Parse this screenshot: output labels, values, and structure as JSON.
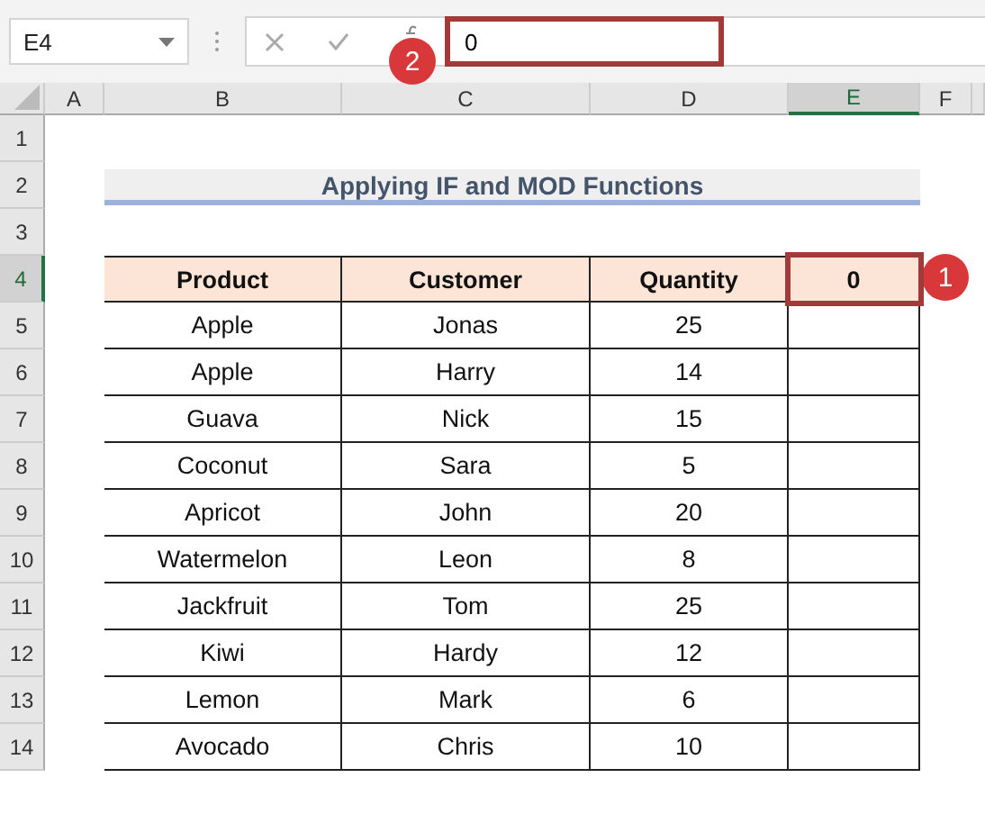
{
  "name_box": "E4",
  "formula_bar": {
    "value": "0",
    "highlighted": true
  },
  "callouts": [
    {
      "label": "1"
    },
    {
      "label": "2"
    }
  ],
  "columns": [
    {
      "label": "A",
      "selected": false
    },
    {
      "label": "B",
      "selected": false
    },
    {
      "label": "C",
      "selected": false
    },
    {
      "label": "D",
      "selected": false
    },
    {
      "label": "E",
      "selected": true
    },
    {
      "label": "F",
      "selected": false
    }
  ],
  "rows": [
    {
      "label": "1",
      "selected": false
    },
    {
      "label": "2",
      "selected": false
    },
    {
      "label": "3",
      "selected": false
    },
    {
      "label": "4",
      "selected": true
    },
    {
      "label": "5",
      "selected": false
    },
    {
      "label": "6",
      "selected": false
    },
    {
      "label": "7",
      "selected": false
    },
    {
      "label": "8",
      "selected": false
    },
    {
      "label": "9",
      "selected": false
    },
    {
      "label": "10",
      "selected": false
    },
    {
      "label": "11",
      "selected": false
    },
    {
      "label": "12",
      "selected": false
    },
    {
      "label": "13",
      "selected": false
    },
    {
      "label": "14",
      "selected": false
    }
  ],
  "title": "Applying IF and MOD Functions",
  "table": {
    "columns": [
      {
        "label": "Product",
        "selected": false
      },
      {
        "label": "Customer",
        "selected": false
      },
      {
        "label": "Quantity",
        "selected": false
      },
      {
        "label": "0",
        "selected": true
      }
    ],
    "rows": [
      [
        "Apple",
        "Jonas",
        "25"
      ],
      [
        "Apple",
        "Harry",
        "14"
      ],
      [
        "Guava",
        "Nick",
        "15"
      ],
      [
        "Coconut",
        "Sara",
        "5"
      ],
      [
        "Apricot",
        "John",
        "20"
      ],
      [
        "Watermelon",
        "Leon",
        "8"
      ],
      [
        "Jackfruit",
        "Tom",
        "25"
      ],
      [
        "Kiwi",
        "Hardy",
        "12"
      ],
      [
        "Lemon",
        "Mark",
        "6"
      ],
      [
        "Avocado",
        "Chris",
        "10"
      ]
    ]
  }
}
